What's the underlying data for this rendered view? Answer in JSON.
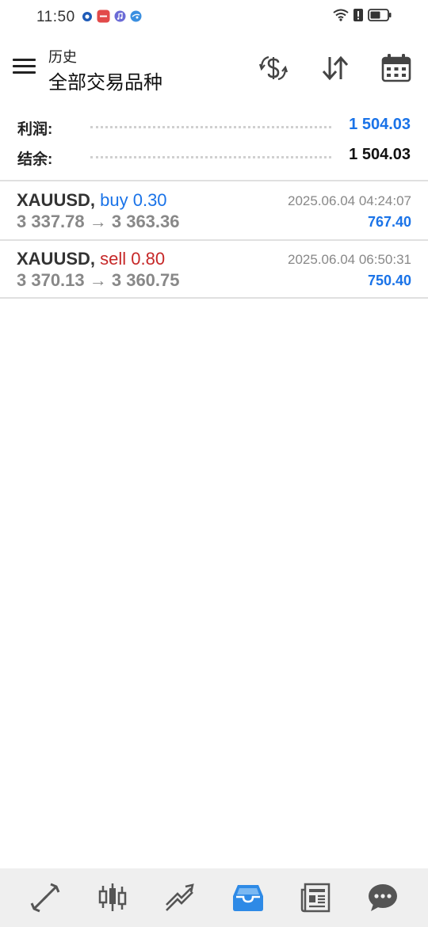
{
  "status_bar": {
    "time": "11:50"
  },
  "header": {
    "subtitle": "历史",
    "title": "全部交易品种"
  },
  "summary": {
    "profit_label": "利润:",
    "profit_value": "1 504.03",
    "balance_label": "结余:",
    "balance_value": "1 504.03"
  },
  "trades": [
    {
      "symbol": "XAUUSD,",
      "side": "buy 0.30",
      "prices": "3 337.78 → 3 363.36",
      "time": "2025.06.04 04:24:07",
      "profit": "767.40"
    },
    {
      "symbol": "XAUUSD,",
      "side": "sell 0.80",
      "prices": "3 370.13 → 3 360.75",
      "time": "2025.06.04 06:50:31",
      "profit": "750.40"
    }
  ],
  "colors": {
    "accent": "#1a73e8",
    "sell": "#c62828",
    "nav_active": "#2e8ae6",
    "nav_inactive": "#555555"
  },
  "bottom_nav": [
    "quotes-icon",
    "chart-candles-icon",
    "trade-icon",
    "history-inbox-icon",
    "news-icon",
    "chat-icon"
  ]
}
